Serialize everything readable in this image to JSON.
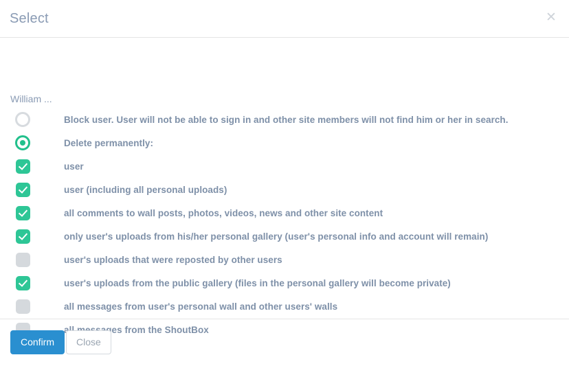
{
  "modal": {
    "title": "Select",
    "close_icon": "close-icon",
    "user_label": "William ...",
    "options": [
      {
        "type": "radio",
        "checked": false,
        "label": "Block user. User will not be able to sign in and other site members will not find him or her in search."
      },
      {
        "type": "radio",
        "checked": true,
        "label": "Delete permanently:"
      },
      {
        "type": "checkbox",
        "checked": true,
        "label": "user"
      },
      {
        "type": "checkbox",
        "checked": true,
        "label": "user (including all personal uploads)"
      },
      {
        "type": "checkbox",
        "checked": true,
        "label": "all comments to wall posts, photos, videos, news and other site content"
      },
      {
        "type": "checkbox",
        "checked": true,
        "label": "only user's uploads from his/her personal gallery (user's personal info and account will remain)"
      },
      {
        "type": "checkbox",
        "checked": false,
        "label": "user's uploads that were reposted by other users"
      },
      {
        "type": "checkbox",
        "checked": true,
        "label": "user's uploads from the public gallery (files in the personal gallery will become private)"
      },
      {
        "type": "checkbox",
        "checked": false,
        "label": "all messages from user's personal wall and other users' walls"
      },
      {
        "type": "checkbox",
        "checked": false,
        "label": "all messages from the ShoutBox"
      }
    ],
    "footer": {
      "confirm_label": "Confirm",
      "close_label": "Close"
    },
    "colors": {
      "accent_green": "#2ec696",
      "accent_blue": "#2a8fd0",
      "label_text": "#7e90a8",
      "title_text": "#8a9bb4",
      "unchecked": "#d5d9dd",
      "border": "#e5e5e5"
    }
  }
}
